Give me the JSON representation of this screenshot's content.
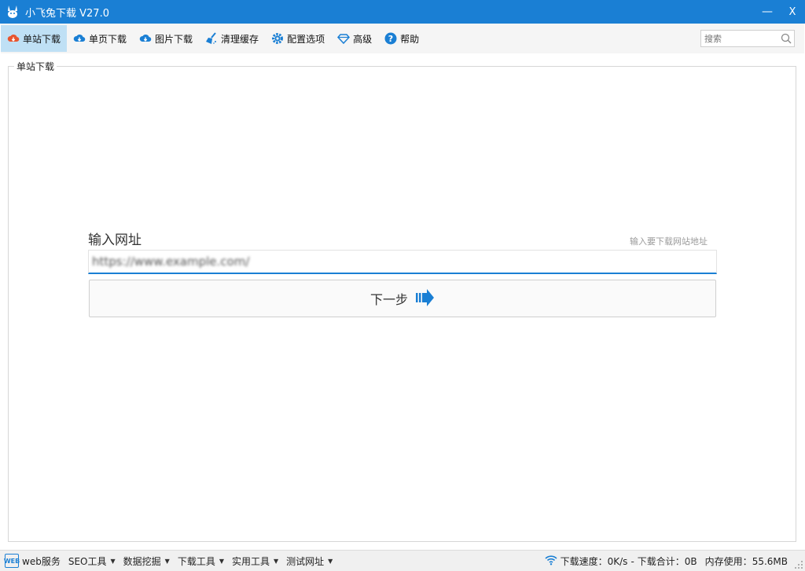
{
  "window": {
    "title": "小飞兔下载 V27.0",
    "minimize": "—",
    "close": "X"
  },
  "toolbar": {
    "items": [
      {
        "label": "单站下载",
        "icon": "cloud-download-icon",
        "color": "#e8552f",
        "active": true
      },
      {
        "label": "单页下载",
        "icon": "cloud-download-icon",
        "color": "#1a7fd4"
      },
      {
        "label": "图片下载",
        "icon": "cloud-download-icon",
        "color": "#1a7fd4"
      },
      {
        "label": "清理缓存",
        "icon": "broom-icon",
        "color": "#1a7fd4"
      },
      {
        "label": "配置选项",
        "icon": "gear-icon",
        "color": "#1a7fd4"
      },
      {
        "label": "高级",
        "icon": "diamond-icon",
        "color": "#1a7fd4"
      },
      {
        "label": "帮助",
        "icon": "help-icon",
        "color": "#1a7fd4"
      }
    ],
    "search_placeholder": "搜索"
  },
  "group": {
    "title": "单站下载"
  },
  "form": {
    "label": "输入网址",
    "hint": "输入要下载网站地址",
    "url_value": "https://www.example.com/",
    "next_label": "下一步"
  },
  "statusbar": {
    "brand": "web服务",
    "menus": [
      "SEO工具",
      "数据挖掘",
      "下载工具",
      "实用工具",
      "测试网址"
    ],
    "speed_label": "下载速度：",
    "speed_value": "0K/s",
    "total_label": "下载合计：",
    "total_value": "0B",
    "memory_label": "内存使用：",
    "memory_value": "55.6MB"
  },
  "colors": {
    "accent": "#1a7fd4",
    "active_tab": "#bfe0f5",
    "active_icon": "#e8552f"
  }
}
